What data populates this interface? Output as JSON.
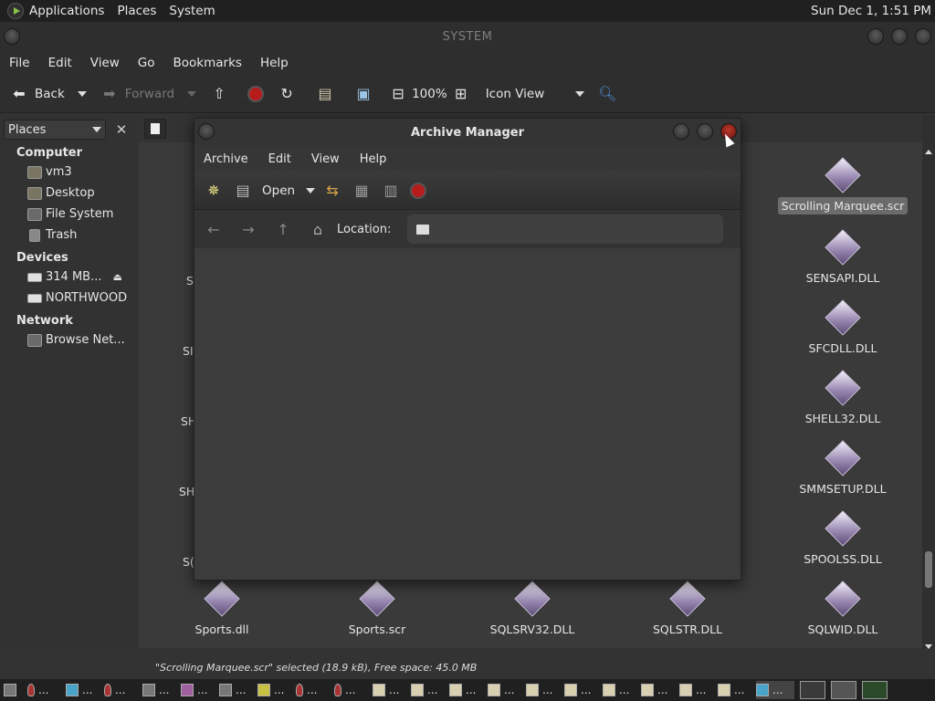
{
  "top_panel": {
    "menus": [
      "Applications",
      "Places",
      "System"
    ],
    "clock": "Sun Dec 1,  1:51 PM"
  },
  "file_manager": {
    "window_title": "SYSTEM",
    "menubar": [
      "File",
      "Edit",
      "View",
      "Go",
      "Bookmarks",
      "Help"
    ],
    "toolbar": {
      "back_label": "Back",
      "forward_label": "Forward",
      "zoom": "100%",
      "view_mode": "Icon View"
    },
    "sidebar": {
      "combo_label": "Places",
      "sections": [
        {
          "heading": "Computer",
          "items": [
            {
              "label": "vm3",
              "icon": "home-folder-icon"
            },
            {
              "label": "Desktop",
              "icon": "desktop-folder-icon"
            },
            {
              "label": "File System",
              "icon": "filesystem-icon"
            },
            {
              "label": "Trash",
              "icon": "trash-icon"
            }
          ]
        },
        {
          "heading": "Devices",
          "items": [
            {
              "label": "314 MB...",
              "icon": "drive-icon",
              "eject": true
            },
            {
              "label": "NORTHWOOD",
              "icon": "drive-icon"
            }
          ]
        },
        {
          "heading": "Network",
          "items": [
            {
              "label": "Browse Net...",
              "icon": "network-icon"
            }
          ]
        }
      ]
    },
    "files": {
      "right_column": [
        "Scrolling Marquee.scr",
        "SENSAPI.DLL",
        "SFCDLL.DLL",
        "SHELL32.DLL",
        "SMMSETUP.DLL",
        "SPOOLSS.DLL",
        "SQLWID.DLL"
      ],
      "bottom_row": [
        "Sports.dll",
        "Sports.scr",
        "SQLSRV32.DLL",
        "SQLSTR.DLL"
      ],
      "partial_left": [
        "S",
        "SI",
        "SH",
        "SH",
        "S("
      ],
      "selected": "Scrolling Marquee.scr"
    },
    "statusbar": "\"Scrolling Marquee.scr\" selected (18.9 kB), Free space: 45.0 MB"
  },
  "archive_manager": {
    "title": "Archive Manager",
    "menubar": [
      "Archive",
      "Edit",
      "View",
      "Help"
    ],
    "open_label": "Open",
    "location_label": "Location:"
  },
  "taskbar": {
    "ellipsis": "..."
  }
}
